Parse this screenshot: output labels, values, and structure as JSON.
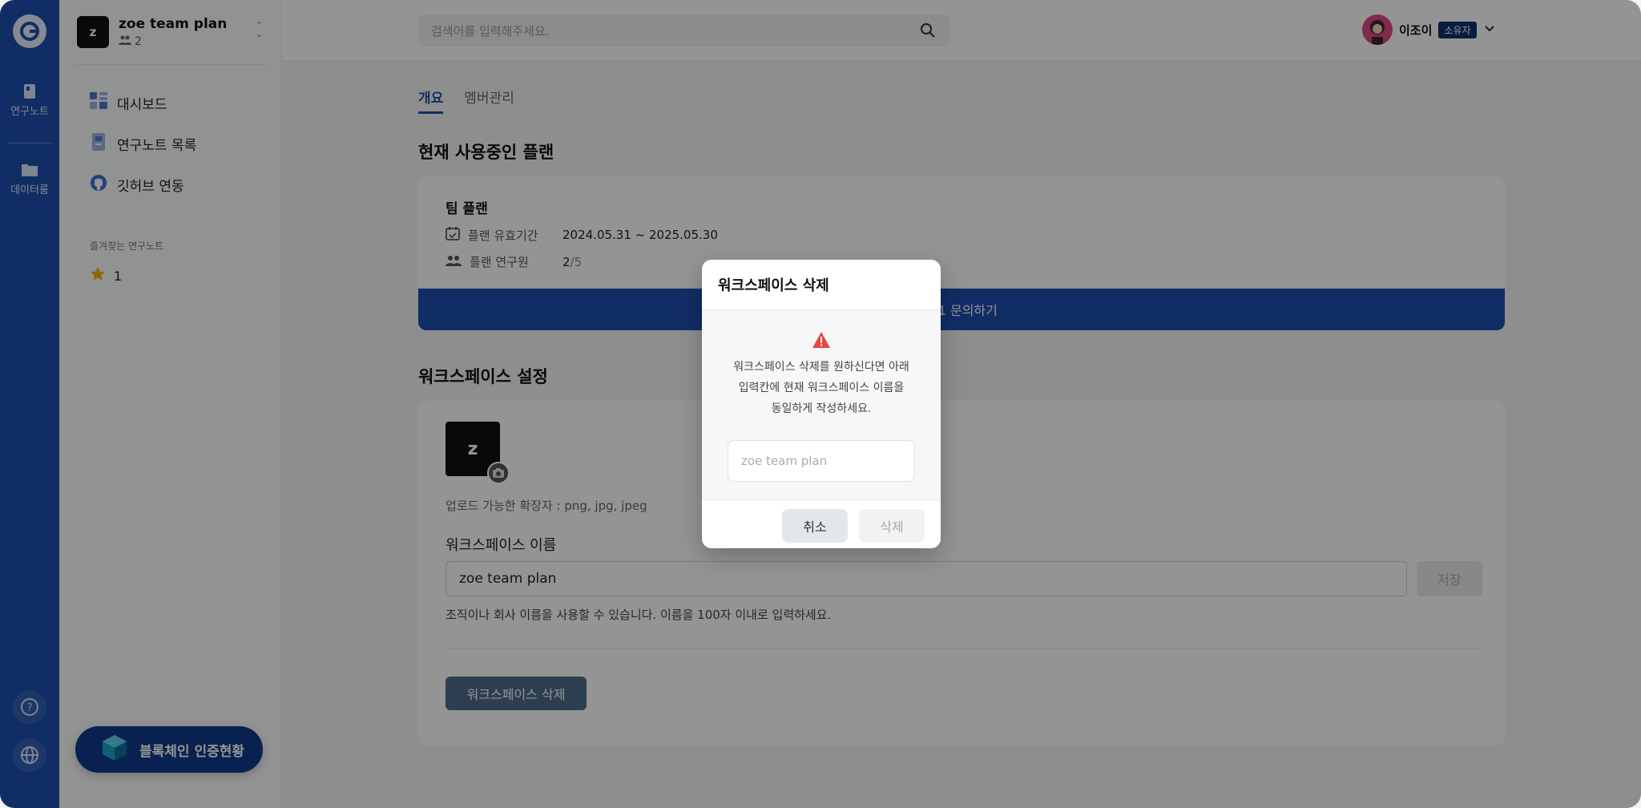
{
  "rail": {
    "items": [
      {
        "label": "연구노트",
        "icon": "notebook-icon"
      },
      {
        "label": "데이터룸",
        "icon": "folder-icon"
      }
    ]
  },
  "sidebar": {
    "workspace": {
      "initial": "z",
      "name": "zoe team plan",
      "member_count": "2"
    },
    "nav": [
      {
        "label": "대시보드",
        "icon": "dashboard-icon"
      },
      {
        "label": "연구노트 목록",
        "icon": "notebook-list-icon"
      },
      {
        "label": "깃허브 연동",
        "icon": "github-icon"
      }
    ],
    "favorites_title": "즐겨찾는 연구노트",
    "favorites": [
      {
        "label": "1"
      }
    ],
    "blockchain_button": "블록체인 인증현황"
  },
  "topbar": {
    "search_placeholder": "검색어를 입력해주세요.",
    "user_name": "이조이",
    "user_role": "소유자"
  },
  "main": {
    "tabs": [
      {
        "label": "개요",
        "active": true
      },
      {
        "label": "멤버관리",
        "active": false
      }
    ],
    "current_plan_title": "현재 사용중인 플랜",
    "plan": {
      "name": "팀 플랜",
      "period_label": "플랜 유효기간",
      "period_value": "2024.05.31 ~ 2025.05.30",
      "members_label": "플랜 연구원",
      "members_used": "2",
      "members_total": "/5",
      "inquiry_button": "1:1 문의하기"
    },
    "settings_title": "워크스페이스 설정",
    "settings": {
      "avatar_initial": "z",
      "extensions_note": "업로드 가능한 확장자 : png, jpg, jpeg",
      "name_label": "워크스페이스 이름",
      "name_value": "zoe team plan",
      "save_button": "저장",
      "hint": "조직이나 회사 이름을 사용할 수 있습니다. 이름을 100자 이내로 입력하세요.",
      "delete_button": "워크스페이스 삭제"
    }
  },
  "modal": {
    "title": "워크스페이스 삭제",
    "message_line1": "워크스페이스 삭제를 원하신다면 아래",
    "message_line2": "입력칸에 현재 워크스페이스 이름을",
    "message_line3": "동일하게 작성하세요.",
    "input_placeholder": "zoe team plan",
    "cancel_button": "취소",
    "confirm_button": "삭제"
  },
  "colors": {
    "brand": "#1e4fae",
    "warning": "#e5483d",
    "owner_badge": "#0f2f6e"
  }
}
